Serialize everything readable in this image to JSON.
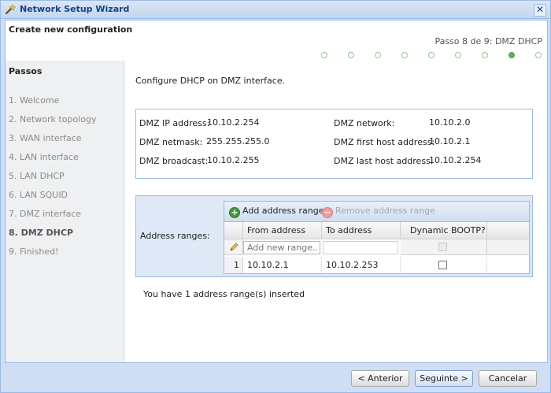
{
  "window": {
    "title": "Network Setup Wizard",
    "close_glyph": "✕"
  },
  "header": {
    "title": "Create new configuration",
    "step_text": "Passo 8 de 9: DMZ DHCP",
    "total_steps": 9,
    "current_step": 8
  },
  "sidebar": {
    "title": "Passos",
    "steps": [
      "1. Welcome",
      "2. Network topology",
      "3. WAN interface",
      "4. LAN interface",
      "5. LAN DHCP",
      "6. LAN SQUID",
      "7. DMZ interface",
      "8. DMZ DHCP",
      "9. Finished!"
    ]
  },
  "main": {
    "intro": "Configure DHCP on DMZ interface.",
    "info": {
      "ip_label": "DMZ IP address:",
      "ip_value": "10.10.2.254",
      "netmask_label": "DMZ netmask:",
      "netmask_value": "255.255.255.0",
      "broadcast_label": "DMZ broadcast:",
      "broadcast_value": "10.10.2.255",
      "network_label": "DMZ network:",
      "network_value": "10.10.2.0",
      "first_label": "DMZ first host address:",
      "first_value": "10.10.2.1",
      "last_label": "DMZ last host address:",
      "last_value": "10.10.2.254"
    },
    "ranges": {
      "label": "Address ranges:",
      "add_label": "Add address range",
      "remove_label": "Remove address range",
      "columns": [
        "From address",
        "To address",
        "Dynamic BOOTP?"
      ],
      "new_placeholder": "Add new range...",
      "rows": [
        {
          "num": "1",
          "from": "10.10.2.1",
          "to": "10.10.2.253",
          "bootp": false
        }
      ]
    },
    "count_text": "You have 1 address range(s) inserted"
  },
  "footer": {
    "prev": "< Anterior",
    "next": "Seguinte >",
    "cancel": "Cancelar"
  },
  "colors": {
    "accent": "#15428b",
    "border": "#99bbe8",
    "progress_active": "#6aa96a"
  }
}
